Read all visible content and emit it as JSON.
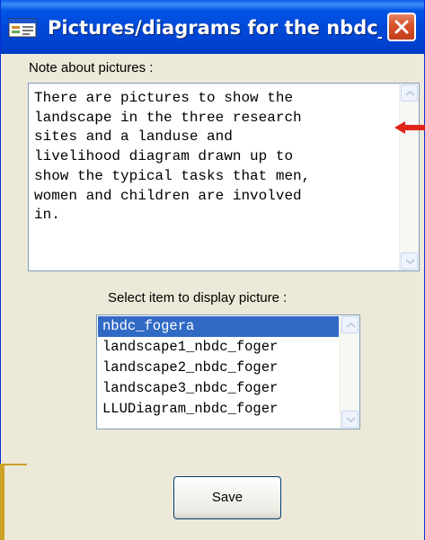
{
  "window": {
    "title": "Pictures/diagrams for the nbdc_...",
    "close_label": "×"
  },
  "note": {
    "label": "Note about pictures :",
    "text": "There are pictures to show the\nlandscape in the three research\nsites and a landuse and\nlivelihood diagram drawn up to\nshow the typical tasks that men,\nwomen and children are involved\nin."
  },
  "picture_list": {
    "label": "Select item to display picture :",
    "items": [
      "nbdc_fogera",
      "landscape1_nbdc_foger",
      "landscape2_nbdc_foger",
      "landscape3_nbdc_foger",
      "LLUDiagram_nbdc_foger"
    ],
    "selected": "nbdc_fogera"
  },
  "actions": {
    "save_label": "Save"
  },
  "colors": {
    "titlebar": "#0055e5",
    "selection": "#316ac5",
    "window_face": "#ece9d8",
    "pointer_arrow": "#e2231a",
    "slide_accent": "#c9a227"
  },
  "icons": {
    "app": "window-app-icon",
    "close": "close-icon",
    "scroll_up": "chevron-up-icon",
    "scroll_down": "chevron-down-icon",
    "pointer": "arrow-left-icon"
  }
}
